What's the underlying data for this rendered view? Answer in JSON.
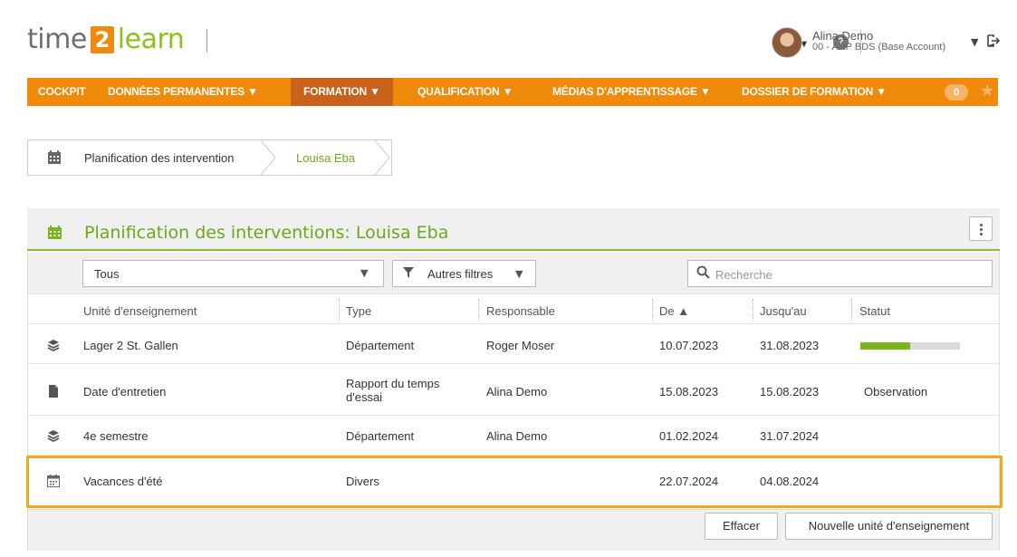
{
  "header": {
    "logo_a": "time",
    "logo_num": "2",
    "logo_b": "learn",
    "lang": "FR",
    "help": "?",
    "user_name": "Alina Demo",
    "user_sub": "00 - ANP BDS (Base Account)"
  },
  "nav": {
    "items": [
      {
        "label": "COCKPIT",
        "active": false
      },
      {
        "label": "DONNÉES PERMANENTES ▼",
        "active": false
      },
      {
        "label": "FORMATION ▼",
        "active": true
      },
      {
        "label": "QUALIFICATION ▼",
        "active": false
      },
      {
        "label": "MÉDIAS D'APPRENTISSAGE ▼",
        "active": false
      },
      {
        "label": "DOSSIER DE FORMATION ▼",
        "active": false
      }
    ],
    "badge": "0"
  },
  "breadcrumb": {
    "item1": "Planification des intervention",
    "item2": "Louisa Eba"
  },
  "panel": {
    "title": "Planification des interventions: Louisa Eba",
    "filter_value": "Tous",
    "filter_more": "Autres filtres",
    "search_placeholder": "Recherche"
  },
  "table": {
    "headers": {
      "unit": "Unité d'enseignement",
      "type": "Type",
      "responsible": "Responsable",
      "from": "De ▲",
      "to": "Jusqu'au",
      "status": "Statut"
    },
    "rows": [
      {
        "icon": "layers-icon",
        "unit": "Lager 2 St. Gallen",
        "type": "Département",
        "type2": "",
        "responsible": "Roger Moser",
        "from": "10.07.2023",
        "to": "31.08.2023",
        "status": "",
        "progress": 0.5
      },
      {
        "icon": "document-icon",
        "unit": "Date d'entretien",
        "type": "Rapport du temps",
        "type2": "d'essai",
        "responsible": "Alina Demo",
        "from": "15.08.2023",
        "to": "15.08.2023",
        "status": "Observation"
      },
      {
        "icon": "layers-icon",
        "unit": "4e semestre",
        "type": "Département",
        "type2": "",
        "responsible": "Alina Demo",
        "from": "01.02.2024",
        "to": "31.07.2024",
        "status": ""
      },
      {
        "icon": "calendar-icon",
        "unit": "Vacances d'été",
        "type": "Divers",
        "type2": "",
        "responsible": "",
        "from": "22.07.2024",
        "to": "04.08.2024",
        "status": ""
      }
    ]
  },
  "buttons": {
    "clear": "Effacer",
    "new_unit": "Nouvelle unité d'enseignement"
  },
  "colors": {
    "orange": "#f08a0a",
    "green": "#8cc021",
    "highlight": "#f0a81e"
  }
}
